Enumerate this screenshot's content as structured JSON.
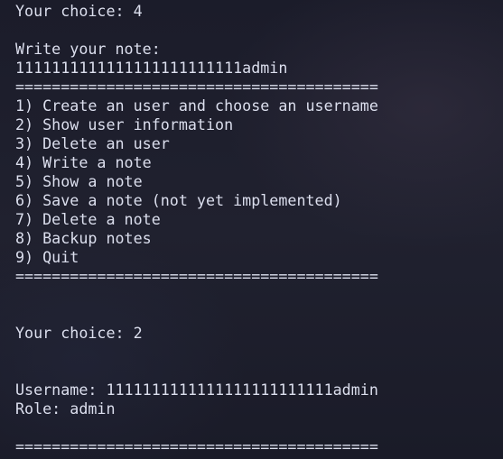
{
  "terminal": {
    "lines": [
      "Your choice: 4",
      "",
      "Write your note:",
      "1111111111111111111111111admin",
      "========================================",
      "1) Create an user and choose an username",
      "2) Show user information",
      "3) Delete an user",
      "4) Write a note",
      "5) Show a note",
      "6) Save a note (not yet implemented)",
      "7) Delete a note",
      "8) Backup notes",
      "9) Quit",
      "========================================",
      "",
      "",
      "Your choice: 2",
      "",
      "",
      "Username: 1111111111111111111111111admin",
      "Role: admin",
      "",
      "========================================"
    ]
  }
}
